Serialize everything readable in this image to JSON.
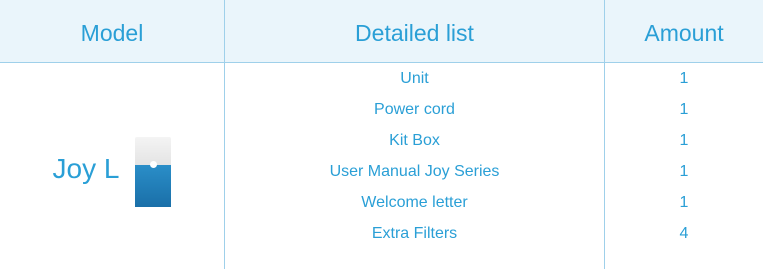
{
  "header": {
    "model": "Model",
    "detailed_list": "Detailed list",
    "amount": "Amount"
  },
  "model": {
    "name": "Joy L",
    "icon": "air-purifier-icon"
  },
  "rows": [
    {
      "item": "Unit",
      "amount": "1"
    },
    {
      "item": "Power cord",
      "amount": "1"
    },
    {
      "item": "Kit Box",
      "amount": "1"
    },
    {
      "item": "User Manual Joy Series",
      "amount": "1"
    },
    {
      "item": "Welcome letter",
      "amount": "1"
    },
    {
      "item": "Extra Filters",
      "amount": "4"
    }
  ],
  "colors": {
    "text": "#2a9fd6",
    "header_bg": "#eaf5fb",
    "grid": "#9fd0ea",
    "purifier_blue": "#1a7fbf"
  }
}
